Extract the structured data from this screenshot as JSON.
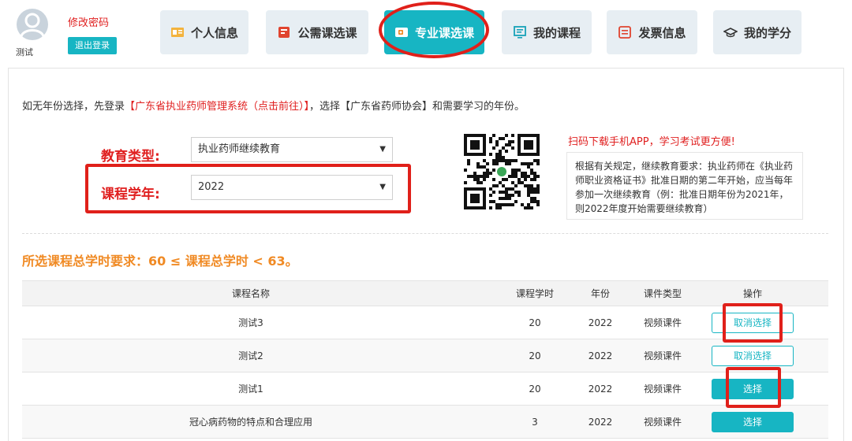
{
  "header": {
    "username": "测试",
    "change_password": "修改密码",
    "logout": "退出登录"
  },
  "nav": {
    "tabs": [
      {
        "label": "个人信息",
        "icon": "id-card-icon"
      },
      {
        "label": "公需课选课",
        "icon": "book-icon"
      },
      {
        "label": "专业课选课",
        "icon": "video-icon",
        "active": true
      },
      {
        "label": "我的课程",
        "icon": "monitor-icon"
      },
      {
        "label": "发票信息",
        "icon": "invoice-icon"
      },
      {
        "label": "我的学分",
        "icon": "graduation-cap-icon"
      }
    ]
  },
  "notice": {
    "prefix": "如无年份选择，先登录",
    "link": "【广东省执业药师管理系统（点击前往）】",
    "suffix": "，选择【广东省药师协会】和需要学习的年份。"
  },
  "form": {
    "education_type_label": "教育类型:",
    "education_type_value": "执业药师继续教育",
    "course_year_label": "课程学年:",
    "course_year_value": "2022"
  },
  "app_promo": "扫码下载手机APP，学习考试更方便!",
  "rule_text": "根据有关规定，继续教育要求：执业药师在《执业药师职业资格证书》批准日期的第二年开始，应当每年参加一次继续教育（例：批准日期年份为2021年，则2022年度开始需要继续教育）",
  "hours_requirement": "所选课程总学时要求：60 ≤ 课程总学时 < 63。",
  "table": {
    "headers": {
      "name": "课程名称",
      "hours": "课程学时",
      "year": "年份",
      "type": "课件类型",
      "op": "操作"
    },
    "rows": [
      {
        "name": "测试3",
        "hours": "20",
        "year": "2022",
        "type": "视频课件",
        "op": "取消选择",
        "selected": true
      },
      {
        "name": "测试2",
        "hours": "20",
        "year": "2022",
        "type": "视频课件",
        "op": "取消选择",
        "selected": true
      },
      {
        "name": "测试1",
        "hours": "20",
        "year": "2022",
        "type": "视频课件",
        "op": "选择",
        "selected": false
      },
      {
        "name": "冠心病药物的特点和合理应用",
        "hours": "3",
        "year": "2022",
        "type": "视频课件",
        "op": "选择",
        "selected": false
      }
    ]
  },
  "colors": {
    "accent": "#17b5c3",
    "warning": "#e02020",
    "orange": "#f08a24",
    "annotation": "#e0201a"
  }
}
